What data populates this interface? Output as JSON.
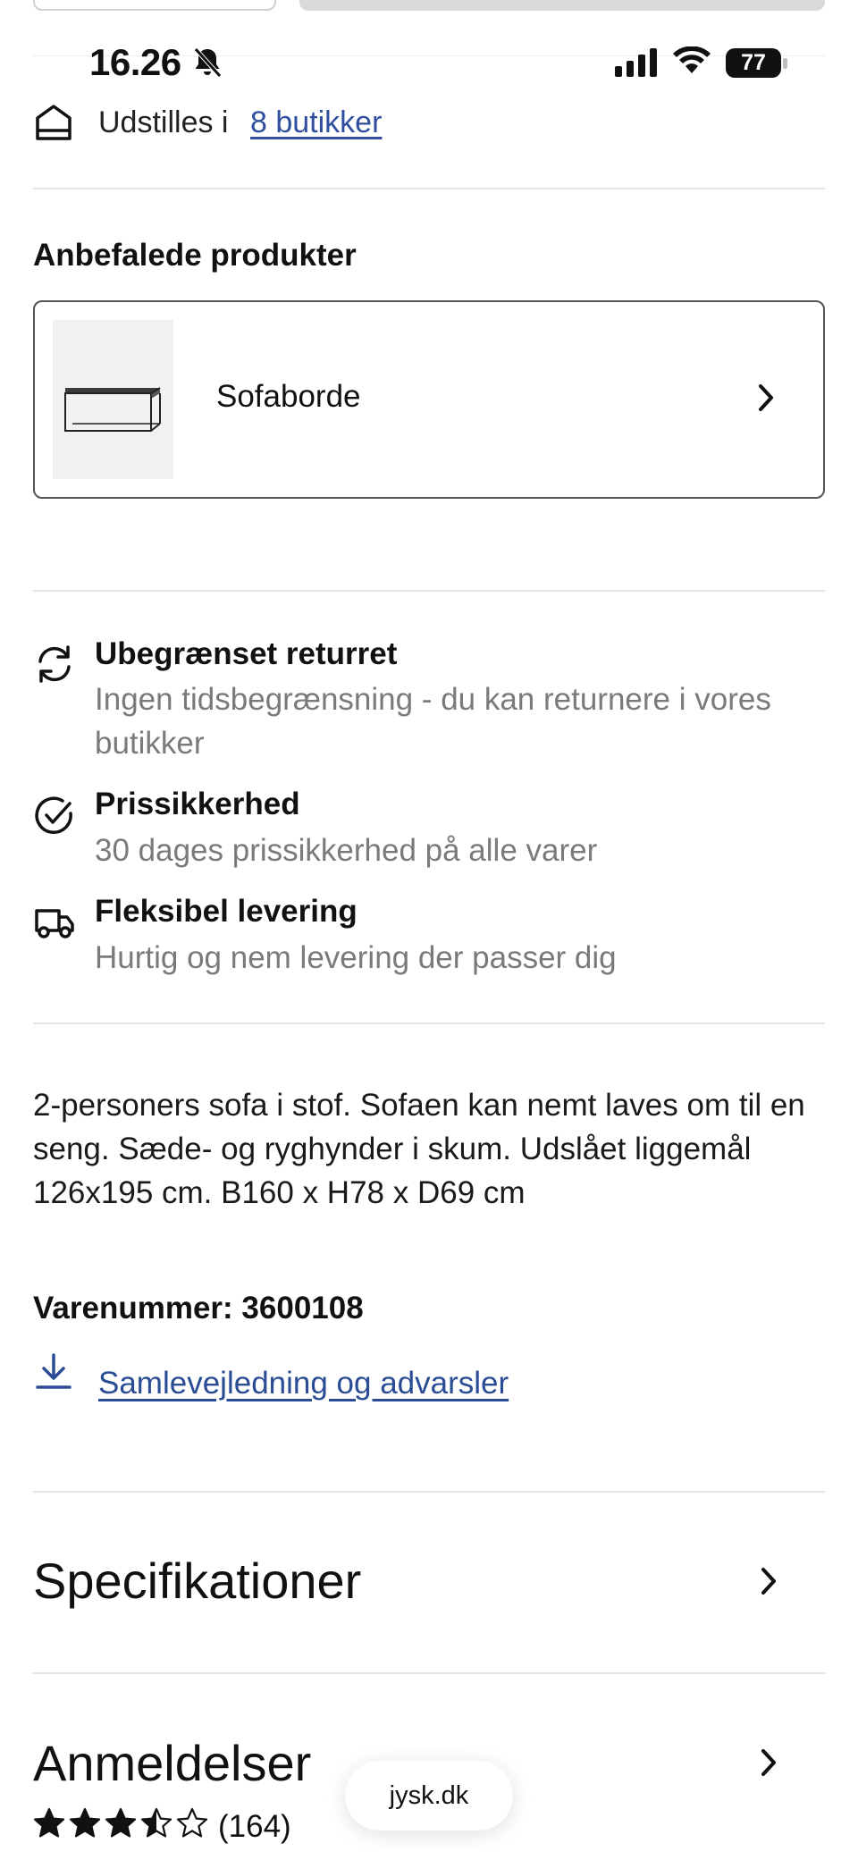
{
  "status_bar": {
    "time": "16.26",
    "battery": "77"
  },
  "availability": {
    "prefix": "Udstilles i",
    "link": "8 butikker"
  },
  "recommended": {
    "title": "Anbefalede produkter",
    "items": [
      {
        "label": "Sofaborde"
      }
    ]
  },
  "features": [
    {
      "icon": "refresh-icon",
      "title": "Ubegrænset returret",
      "subtitle_line1": "Ingen tidsbegrænsning - du kan returnere i vores",
      "subtitle_line2": "butikker"
    },
    {
      "icon": "check-circle-icon",
      "title": "Prissikkerhed",
      "subtitle_line1": "30 dages prissikkerhed på alle varer"
    },
    {
      "icon": "truck-icon",
      "title": "Fleksibel levering",
      "subtitle_line1": "Hurtig og nem levering der passer dig"
    }
  ],
  "description": {
    "line1": "2-personers sofa i stof. Sofaen kan nemt laves om til en",
    "line2": "seng. Sæde- og ryghynder i skum. Udslået liggemål",
    "line3": "126x195 cm. B160 x H78 x D69 cm"
  },
  "sku": "Varenummer: 3600108",
  "download_link": "Samlevejledning og advarsler",
  "sections": {
    "specs": "Specifikationer",
    "reviews": "Anmeldelser"
  },
  "rating": {
    "value": 3.5,
    "max": 5,
    "count": "(164)"
  },
  "browser_pill": "jysk.dk",
  "colors": {
    "link": "#2f4f9e",
    "muted": "#7a7a7a",
    "divider": "#e3e3e3"
  }
}
